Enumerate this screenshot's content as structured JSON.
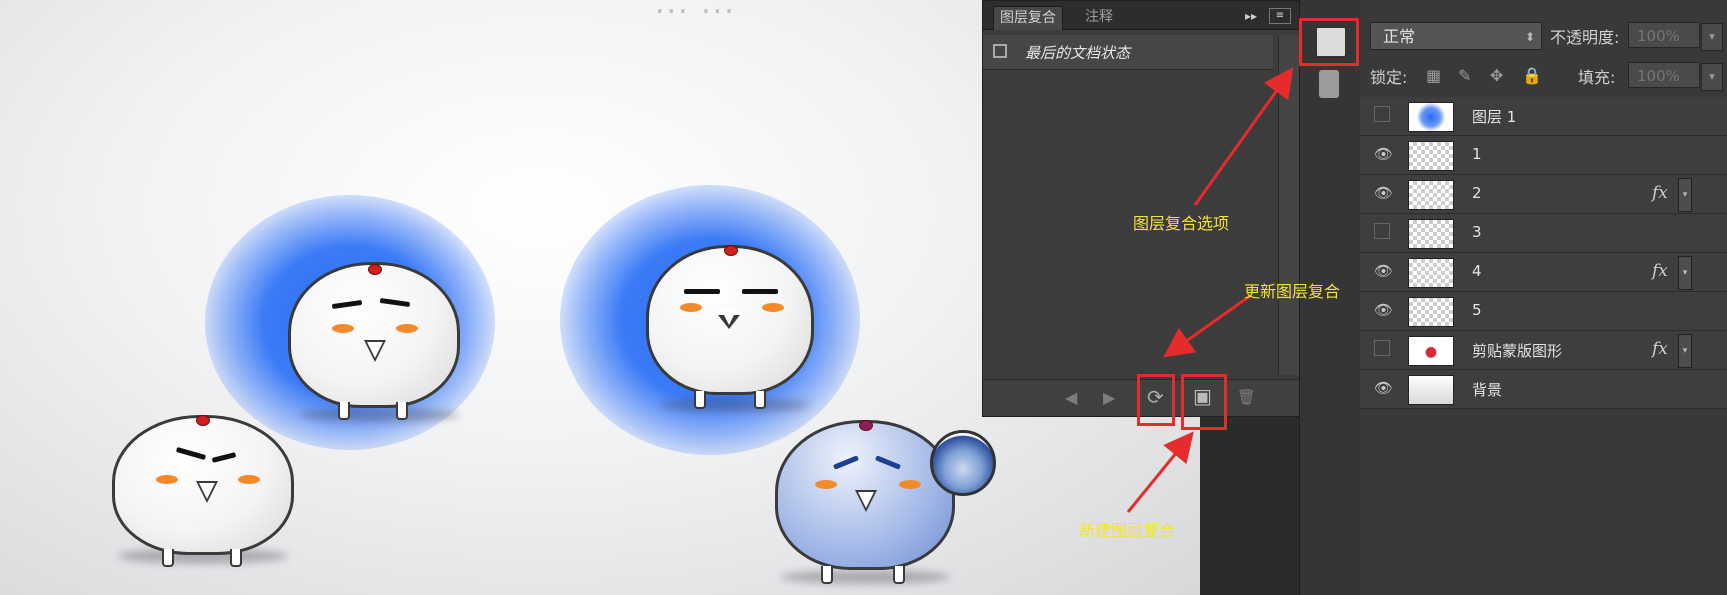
{
  "canvas": {
    "title_fragment": "... ..."
  },
  "layer_comps_panel": {
    "tabs": [
      "图层复合",
      "注释"
    ],
    "collapse_glyph": "▸▸",
    "menu_glyph": "≡",
    "comp_row_label": "最后的文档状态",
    "footer_buttons": [
      {
        "name": "prev-comp",
        "glyph": "◀"
      },
      {
        "name": "next-comp",
        "glyph": "▶"
      },
      {
        "name": "update-comp",
        "glyph": "⟳"
      },
      {
        "name": "new-comp",
        "glyph": "▣"
      },
      {
        "name": "delete-comp",
        "glyph": "🗑"
      }
    ]
  },
  "layers_panel": {
    "blend_mode": "正常",
    "opacity_label": "不透明度:",
    "opacity_value": "100%",
    "lock_label": "锁定:",
    "fill_label": "填充:",
    "fill_value": "100%",
    "layers": [
      {
        "name": "图层 1",
        "visible": false,
        "fx": false,
        "thumb": "blue"
      },
      {
        "name": "1",
        "visible": true,
        "fx": false,
        "thumb": "checker"
      },
      {
        "name": "2",
        "visible": true,
        "fx": true,
        "thumb": "checker"
      },
      {
        "name": "3",
        "visible": false,
        "fx": false,
        "thumb": "checker"
      },
      {
        "name": "4",
        "visible": true,
        "fx": true,
        "thumb": "checker"
      },
      {
        "name": "5",
        "visible": true,
        "fx": false,
        "thumb": "checker"
      },
      {
        "name": "剪贴蒙版图形",
        "visible": false,
        "fx": true,
        "thumb": "heart"
      },
      {
        "name": "背景",
        "visible": true,
        "fx": false,
        "thumb": "white"
      }
    ],
    "fx_glyph": "fx",
    "eye_glyph": "👁"
  },
  "annotations": {
    "layer_comp_options": "图层复合选项",
    "update_layer_comp": "更新图层复合",
    "new_layer_comp": "新建图层复合"
  },
  "colors": {
    "annotation": "#f3e238",
    "highlight": "#e52b2b",
    "glow": "#2a6cf5"
  }
}
